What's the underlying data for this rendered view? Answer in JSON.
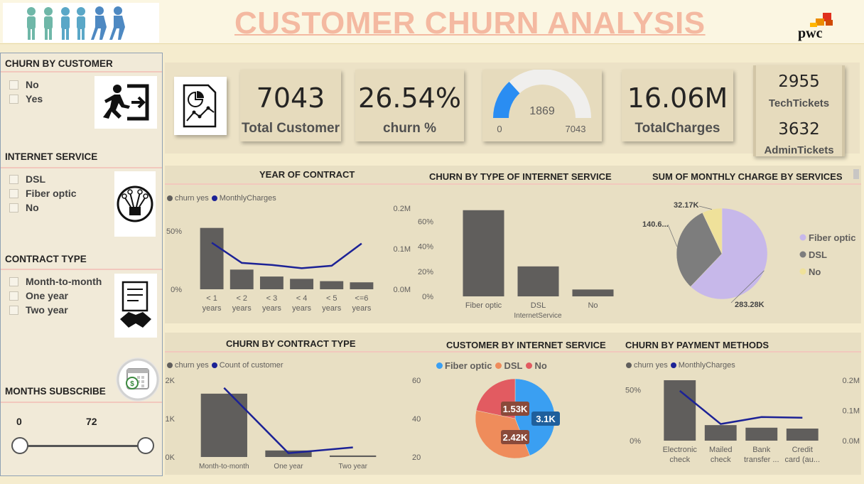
{
  "header": {
    "title": "CUSTOMER CHURN ANALYSIS",
    "brand": "pwc"
  },
  "filters": {
    "churn": {
      "title": "CHURN BY  CUSTOMER",
      "options": [
        "No",
        "Yes"
      ]
    },
    "internet": {
      "title": "INTERNET SERVICE",
      "options": [
        "DSL",
        "Fiber optic",
        "No"
      ]
    },
    "contract": {
      "title": "CONTRACT TYPE",
      "options": [
        "Month-to-month",
        "One year",
        "Two year"
      ]
    },
    "months": {
      "title": "MONTHS SUBSCRIBE",
      "min": "0",
      "max": "72"
    }
  },
  "kpis": {
    "total_customer": {
      "value": "7043",
      "label": "Total Customer"
    },
    "churn_pct": {
      "value": "26.54%",
      "label": "churn %"
    },
    "gauge": {
      "value": "1869",
      "min": "0",
      "max": "7043",
      "fraction": 0.2654
    },
    "total_charges": {
      "value": "16.06M",
      "label": "TotalCharges"
    },
    "tickets": {
      "tech_value": "2955",
      "tech_label": "TechTickets",
      "admin_value": "3632",
      "admin_label": "AdminTickets"
    }
  },
  "colors": {
    "bar": "#605e5c",
    "line": "#1c2296",
    "fiber": "#c7b8ea",
    "dsl": "#7d7d7d",
    "no": "#efe19a",
    "donut_fiber": "#3a9ff2",
    "donut_dsl": "#ef8c5b",
    "donut_no": "#e25b61",
    "gauge_fill": "#2a8df2",
    "title_pink": "#f4b9a1"
  },
  "icons": [
    "people-logo-icon",
    "pwc-logo-icon",
    "exit-icon",
    "network-icon",
    "contract-handshake-icon",
    "calendar-money-icon",
    "report-chart-icon"
  ],
  "chart_data": [
    {
      "id": "year_of_contract",
      "type": "bar",
      "title": "YEAR OF CONTRACT",
      "categories": [
        "< 1 years",
        "< 2 years",
        "< 3 years",
        "< 4 years",
        "< 5 years",
        "<=6 years"
      ],
      "series": [
        {
          "name": "churn yes",
          "kind": "bar",
          "axis": "left",
          "values": [
            53,
            17,
            11,
            9,
            7,
            6
          ]
        },
        {
          "name": "MonthlyCharges",
          "kind": "line",
          "axis": "right",
          "values": [
            0.115,
            0.065,
            0.06,
            0.052,
            0.058,
            0.113
          ]
        }
      ],
      "y_left": {
        "ticks": [
          "0%",
          "50%"
        ],
        "range": [
          0,
          70
        ]
      },
      "y_right": {
        "ticks": [
          "0.0M",
          "0.1M",
          "0.2M"
        ],
        "range": [
          0,
          0.2
        ]
      }
    },
    {
      "id": "churn_by_internet",
      "type": "bar",
      "title": "CHURN BY TYPE OF INTERNET SERVICE",
      "xlabel": "InternetService",
      "categories": [
        "Fiber optic",
        "DSL",
        "No"
      ],
      "values": [
        69,
        24,
        5.5
      ],
      "y": {
        "ticks": [
          "0%",
          "20%",
          "40%",
          "60%"
        ],
        "range": [
          0,
          70
        ]
      }
    },
    {
      "id": "monthly_charge_by_services",
      "type": "pie",
      "title": "SUM OF MONTHLY CHARGE BY SERVICES",
      "labels": [
        "Fiber optic",
        "DSL",
        "No"
      ],
      "values": [
        283.28,
        140.6,
        32.17
      ],
      "value_labels": [
        "283.28K",
        "140.6...",
        "32.17K"
      ]
    },
    {
      "id": "churn_by_contract",
      "type": "bar",
      "title": "CHURN BY CONTRACT TYPE",
      "categories": [
        "Month-to-month",
        "One year",
        "Two year"
      ],
      "series": [
        {
          "name": "churn yes",
          "kind": "bar",
          "axis": "left",
          "values": [
            1650,
            170,
            40
          ]
        },
        {
          "name": "Count of customer",
          "kind": "line",
          "axis": "right",
          "values": [
            56,
            22,
            25
          ]
        }
      ],
      "y_left": {
        "ticks": [
          "0K",
          "1K",
          "2K"
        ],
        "range": [
          0,
          2000
        ]
      },
      "y_right": {
        "ticks": [
          "20%",
          "40%",
          "60%"
        ],
        "range": [
          20,
          60
        ]
      }
    },
    {
      "id": "customer_by_internet",
      "type": "pie",
      "title": "CUSTOMER BY INTERNET SERVICE",
      "labels": [
        "Fiber optic",
        "DSL",
        "No"
      ],
      "values": [
        3.1,
        2.42,
        1.53
      ],
      "value_labels": [
        "3.1K",
        "2.42K",
        "1.53K"
      ]
    },
    {
      "id": "churn_by_payment",
      "type": "bar",
      "title": "CHURN BY PAYMENT METHODS",
      "categories": [
        "Electronic check",
        "Mailed check",
        "Bank transfer ...",
        "Credit card (au..."
      ],
      "series": [
        {
          "name": "churn yes",
          "kind": "bar",
          "axis": "left",
          "values": [
            70,
            18,
            15,
            14
          ]
        },
        {
          "name": "MonthlyCharges",
          "kind": "line",
          "axis": "right",
          "values": [
            0.165,
            0.055,
            0.078,
            0.076
          ]
        }
      ],
      "y_left": {
        "ticks": [
          "0%",
          "50%"
        ],
        "range": [
          0,
          70
        ]
      },
      "y_right": {
        "ticks": [
          "0.0M",
          "0.1M",
          "0.2M"
        ],
        "range": [
          0,
          0.2
        ]
      }
    }
  ]
}
